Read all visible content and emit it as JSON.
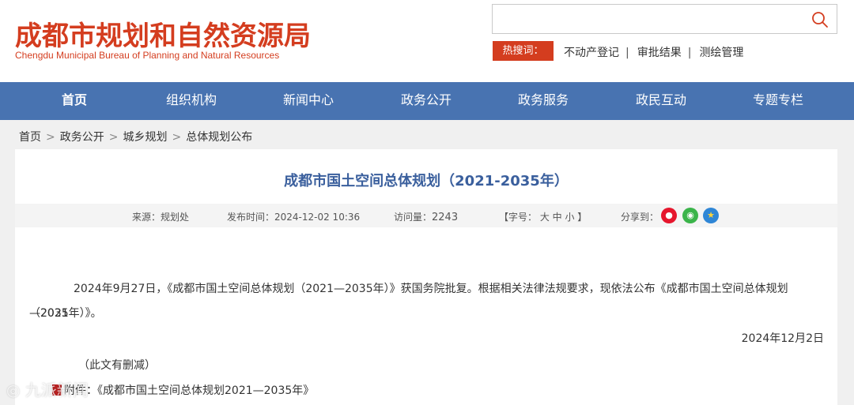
{
  "header": {
    "title": "成都市规划和自然资源局",
    "subtitle": "Chengdu Municipal Bureau of Planning and Natural Resources",
    "search_placeholder": "",
    "hot_label": "热搜词：",
    "hot_links": [
      "不动产登记",
      "审批结果",
      "测绘管理"
    ],
    "hot_sep": "|"
  },
  "nav": {
    "items": [
      "首页",
      "组织机构",
      "新闻中心",
      "政务公开",
      "政务服务",
      "政民互动",
      "专题专栏"
    ],
    "active_index": 0
  },
  "breadcrumb": {
    "items": [
      "首页",
      "政务公开",
      "城乡规划",
      "总体规划公布"
    ],
    "separator": ">"
  },
  "article": {
    "title": "成都市国土空间总体规划（2021-2035年）",
    "meta": {
      "source": "来源：规划处",
      "publish_time": "发布时间：2024-12-02 10:36",
      "visits_label": "访问量：",
      "visits": "2243",
      "font_size": "【字号： 大 中 小 】",
      "share_label": "分享到："
    },
    "share_icons": [
      "weibo-icon",
      "wechat-icon",
      "qzone-icon"
    ],
    "body_line1": "2024年9月27日，《成都市国土空间总体规划（2021—2035年）》获国务院批复。根据相关法律法规要求，现依法公布《成都市国土空间总体规划（2021",
    "body_line2": "—2035年）》。",
    "date": "2024年12月2日",
    "note": "（此文有删减）",
    "attachment": "附件：《成都市国土空间总体规划2021—2035年》"
  },
  "watermark": "九派新闻",
  "colors": {
    "brand_red": "#d43d1f",
    "nav_blue": "#4873b1",
    "title_blue": "#3a5f9d"
  }
}
